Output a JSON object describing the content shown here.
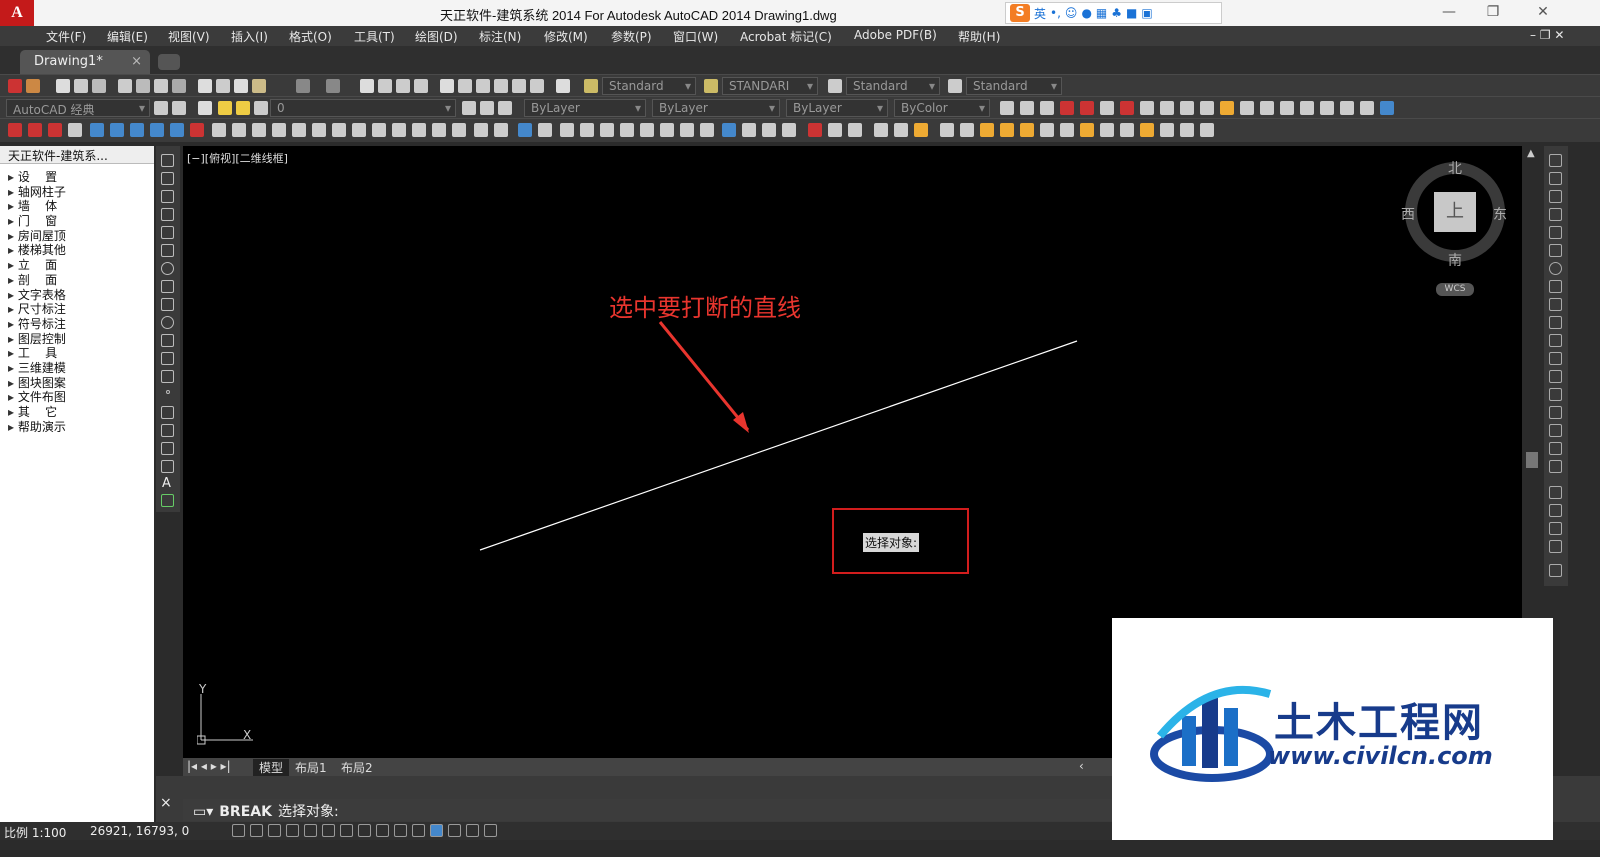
{
  "app": {
    "logo": "A",
    "title": "天正软件-建筑系统 2014  For Autodesk AutoCAD 2014    Drawing1.dwg"
  },
  "ime": {
    "logo": "S",
    "items": [
      "英",
      "•,"
    ]
  },
  "menu": [
    "文件(F)",
    "编辑(E)",
    "视图(V)",
    "插入(I)",
    "格式(O)",
    "工具(T)",
    "绘图(D)",
    "标注(N)",
    "修改(M)",
    "参数(P)",
    "窗口(W)",
    "Acrobat 标记(C)",
    "Adobe PDF(B)",
    "帮助(H)"
  ],
  "tabs": {
    "doc": "Drawing1*",
    "close": "×"
  },
  "toolbar1": {
    "text_style": "Standard",
    "dim_style": "STANDARI",
    "table_style": "Standard",
    "mleader_style": "Standard"
  },
  "toolbar2": {
    "workspace": "AutoCAD 经典",
    "layer": "0",
    "color": "ByLayer",
    "linetype": "ByLayer",
    "lineweight": "ByLayer",
    "plotstyle": "ByColor"
  },
  "left_panel": {
    "title": "天正软件-建筑系...",
    "items": [
      "设    置",
      "轴网柱子",
      "墙    体",
      "门    窗",
      "房间屋顶",
      "楼梯其他",
      "立    面",
      "剖    面",
      "文字表格",
      "尺寸标注",
      "符号标注",
      "图层控制",
      "工    具",
      "三维建模",
      "图块图案",
      "文件布图",
      "其    它",
      "帮助演示"
    ]
  },
  "viewport": {
    "label": "[−][俯视][二维线框]",
    "annotation": "选中要打断的直线",
    "prompt": "选择对象:",
    "compass": {
      "north": "北",
      "south": "南",
      "west": "西",
      "east": "东",
      "face": "上",
      "wcs": "WCS"
    },
    "ucs": {
      "x": "X",
      "y": "Y"
    }
  },
  "layout_tabs": [
    "模型",
    "布局1",
    "布局2"
  ],
  "command": {
    "close": "×",
    "name": "BREAK",
    "prompt": "选择对象:"
  },
  "status": {
    "scale": "比例 1:100",
    "coords": "26921, 16793, 0"
  },
  "watermark": {
    "title": "土木工程网",
    "url": "www.civilcn.com"
  },
  "colors": {
    "annotation": "#e8352e",
    "highlight_box": "#d21d1d",
    "brand": "#173b8b"
  }
}
